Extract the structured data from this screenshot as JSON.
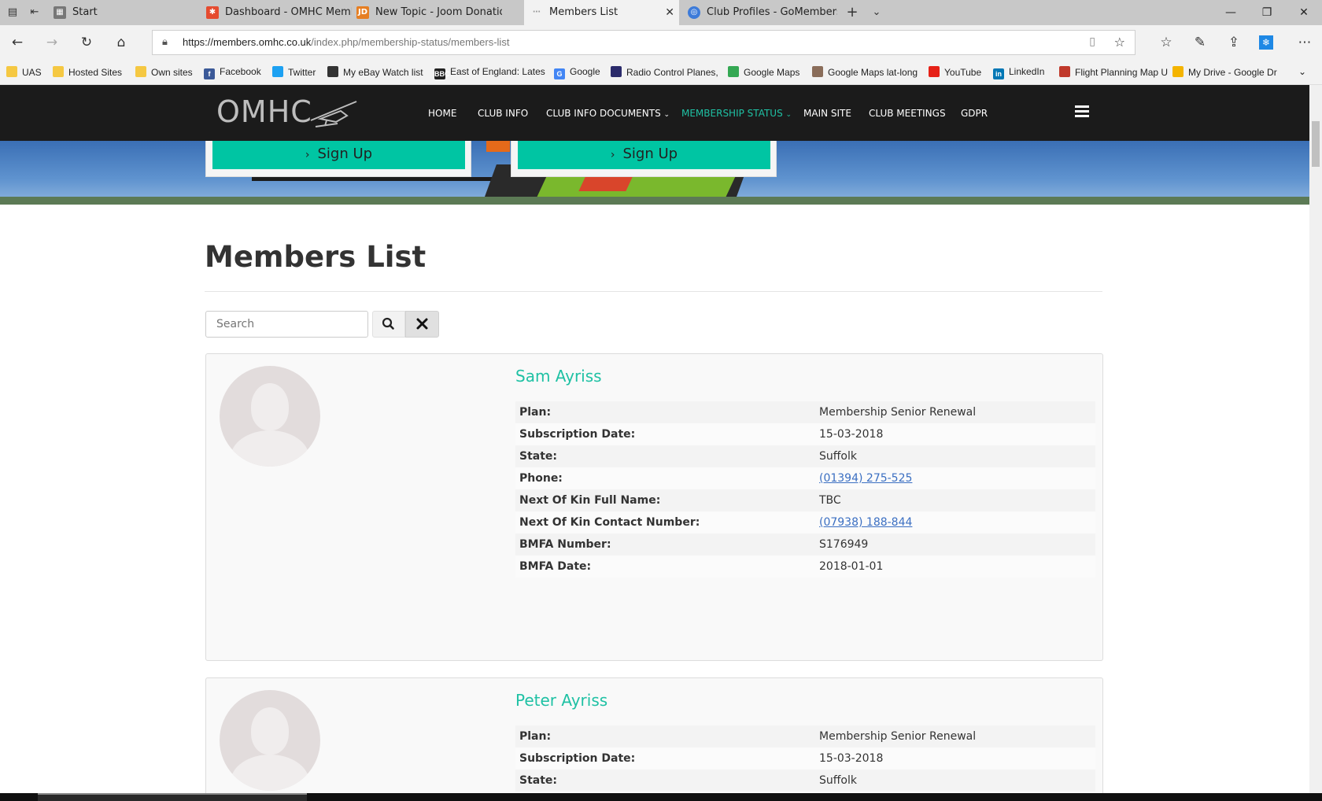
{
  "browser": {
    "tabs": [
      {
        "label": "Start",
        "icon": "start-page-icon"
      },
      {
        "label": "Dashboard - OMHC Membe",
        "icon": "joomla-icon"
      },
      {
        "label": "New Topic - Joom Donatior",
        "icon": "jd-icon",
        "icon_text": "JD"
      },
      {
        "label": "Members List",
        "icon": "loading-icon"
      },
      {
        "label": "Club Profiles - GoMembersl",
        "icon": "gomembers-icon"
      }
    ],
    "url_host": "https://members.omhc.co.uk",
    "url_path": "/index.php/membership-status/members-list",
    "favorites": [
      {
        "label": "UAS",
        "icon": "folder-icon",
        "color": "#f5c842"
      },
      {
        "label": "Hosted Sites",
        "icon": "folder-icon",
        "color": "#f5c842"
      },
      {
        "label": "Own sites",
        "icon": "folder-icon",
        "color": "#f5c842"
      },
      {
        "label": "Facebook",
        "icon": "facebook-icon",
        "color": "#3b5998",
        "icon_text": "f"
      },
      {
        "label": "Twitter",
        "icon": "twitter-icon",
        "color": "#1da1f2"
      },
      {
        "label": "My eBay Watch list",
        "icon": "ebay-icon",
        "color": "#333333"
      },
      {
        "label": "East of England: Lates",
        "icon": "bbc-icon",
        "color": "#222222",
        "icon_text": "BBC"
      },
      {
        "label": "Google",
        "icon": "google-icon",
        "color": "#4285f4",
        "icon_text": "G"
      },
      {
        "label": "Radio Control Planes,",
        "icon": "rc-icon",
        "color": "#2b2b6b"
      },
      {
        "label": "Google Maps",
        "icon": "maps-icon",
        "color": "#34a853"
      },
      {
        "label": "Google Maps lat-long",
        "icon": "maps-latlong-icon",
        "color": "#8a6d5a"
      },
      {
        "label": "YouTube",
        "icon": "youtube-icon",
        "color": "#e62117"
      },
      {
        "label": "LinkedIn",
        "icon": "linkedin-icon",
        "color": "#0077b5",
        "icon_text": "in"
      },
      {
        "label": "Flight Planning Map U",
        "icon": "flight-map-icon",
        "color": "#c0392b"
      },
      {
        "label": "My Drive - Google Dr",
        "icon": "drive-icon",
        "color": "#f4b400"
      }
    ]
  },
  "site": {
    "logo": "OMHC",
    "menu": [
      {
        "label": "HOME",
        "active": false
      },
      {
        "label": "CLUB INFO",
        "active": false
      },
      {
        "label": "CLUB INFO DOCUMENTS",
        "active": false,
        "dropdown": true
      },
      {
        "label": "MEMBERSHIP STATUS",
        "active": true,
        "dropdown": true
      },
      {
        "label": "MAIN SITE",
        "active": false
      },
      {
        "label": "CLUB MEETINGS",
        "active": false
      },
      {
        "label": "GDPR",
        "active": false
      }
    ],
    "signup_label": "Sign Up",
    "accent_color": "#1fc1a4"
  },
  "page": {
    "title": "Members List",
    "search_placeholder": "Search"
  },
  "members": [
    {
      "name": "Sam Ayriss",
      "fields": [
        {
          "label": "Plan:",
          "value": "Membership Senior Renewal"
        },
        {
          "label": "Subscription Date:",
          "value": "15-03-2018"
        },
        {
          "label": "State:",
          "value": "Suffolk"
        },
        {
          "label": "Phone:",
          "value": "(01394) 275-525",
          "link": true
        },
        {
          "label": "Next Of Kin Full Name:",
          "value": "TBC"
        },
        {
          "label": "Next Of Kin Contact Number:",
          "value": "(07938) 188-844",
          "link": true
        },
        {
          "label": "BMFA Number:",
          "value": "S176949"
        },
        {
          "label": "BMFA Date:",
          "value": "2018-01-01"
        }
      ]
    },
    {
      "name": "Peter Ayriss",
      "fields": [
        {
          "label": "Plan:",
          "value": "Membership Senior Renewal"
        },
        {
          "label": "Subscription Date:",
          "value": "15-03-2018"
        },
        {
          "label": "State:",
          "value": "Suffolk"
        }
      ]
    }
  ]
}
